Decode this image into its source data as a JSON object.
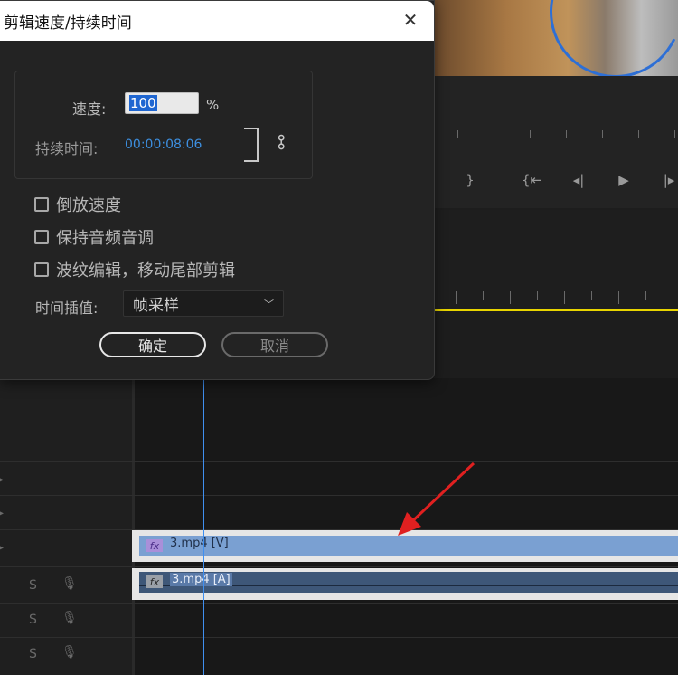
{
  "dialog": {
    "title": "剪辑速度/持续时间",
    "close_glyph": "✕",
    "speed_label": "速度:",
    "speed_value": "100",
    "speed_unit": "%",
    "duration_label": "持续时间:",
    "duration_value": "00:00:08:06",
    "checkboxes": [
      {
        "label": "倒放速度",
        "checked": false
      },
      {
        "label": "保持音频音调",
        "checked": false
      },
      {
        "label": "波纹编辑，移动尾部剪辑",
        "checked": false
      }
    ],
    "interpolation_label": "时间插值:",
    "interpolation_value": "帧采样",
    "ok_label": "确定",
    "cancel_label": "取消"
  },
  "timeline": {
    "video_clip_label": "3.mp4 [V]",
    "audio_clip_label": "3.mp4 [A]",
    "fx_badge": "fx",
    "solo_label": "S"
  },
  "colors": {
    "accent": "#3d8fe0",
    "work_area": "#e8d400",
    "video_clip": "#7aa0d2",
    "audio_clip": "#3e5778",
    "arrow": "#e02020"
  }
}
